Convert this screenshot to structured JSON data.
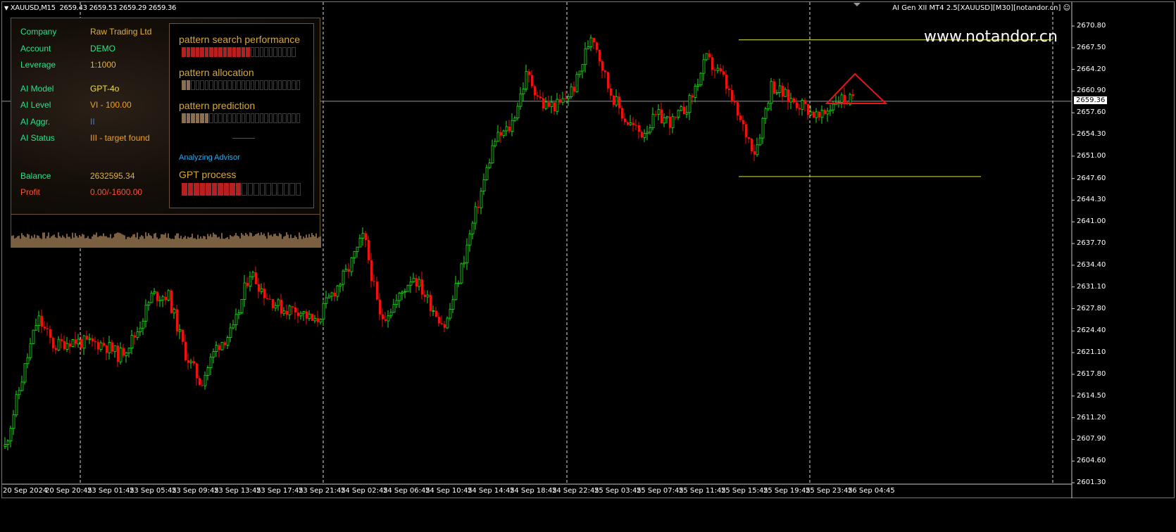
{
  "header": {
    "symbol": "XAUUSD,M15",
    "ohlc": "2659.43 2659.53 2659.29 2659.36",
    "ea_title": "AI Gen XII MT4 2.5[XAUUSD][M30][notandor.cn]",
    "watermark": "www.notandor.cn"
  },
  "info": [
    {
      "label": "Company",
      "value": "Raw Trading Ltd",
      "color": "#e0b040",
      "gap": false
    },
    {
      "label": "Account",
      "value": "DEMO",
      "color": "#2ee08a",
      "gap": false
    },
    {
      "label": "Leverage",
      "value": "1:1000",
      "color": "#e0b040",
      "gap": false
    },
    {
      "label": "AI Model",
      "value": "GPT-4o",
      "color": "#f0e040",
      "gap": true
    },
    {
      "label": "AI Level",
      "value": "VI - 100.00",
      "color": "#f0a020",
      "gap": false
    },
    {
      "label": "AI Aggr.",
      "value": "II",
      "color": "#3a7ae8",
      "gap": false
    },
    {
      "label": "AI Status",
      "value": "III - target found",
      "color": "#f0a020",
      "gap": false
    },
    {
      "label": "Balance",
      "value": "2632595.34",
      "color": "#e0b040",
      "gap": true
    },
    {
      "label": "Profit",
      "value": "0.00/-1600.00",
      "color": "#ff5030",
      "gap": false,
      "labelColor": "#ff5030"
    }
  ],
  "progress": [
    {
      "title": "pattern search performance",
      "filled": 15,
      "total": 25,
      "color": "#b82020"
    },
    {
      "title": "pattern allocation",
      "filled": 2,
      "total": 26,
      "color": "#8a7050"
    },
    {
      "title": "pattern prediction",
      "filled": 6,
      "total": 26,
      "color": "#8a7050"
    }
  ],
  "advisor": {
    "status": "Analyzing Advisor",
    "process_title": "GPT process",
    "filled": 10,
    "total": 20,
    "color": "#b82020"
  },
  "price_axis": {
    "labels": [
      "2670.80",
      "2667.50",
      "2664.20",
      "2660.90",
      "2657.60",
      "2654.30",
      "2651.00",
      "2647.60",
      "2644.30",
      "2641.00",
      "2637.70",
      "2634.40",
      "2631.10",
      "2627.80",
      "2624.40",
      "2621.10",
      "2617.80",
      "2614.50",
      "2611.20",
      "2607.90",
      "2604.60",
      "2601.30"
    ],
    "current": "2659.36"
  },
  "time_axis": [
    "20 Sep 2024",
    "20 Sep 20:45",
    "23 Sep 01:45",
    "23 Sep 05:45",
    "23 Sep 09:45",
    "23 Sep 13:45",
    "23 Sep 17:45",
    "23 Sep 21:45",
    "24 Sep 02:45",
    "24 Sep 06:45",
    "24 Sep 10:45",
    "24 Sep 14:45",
    "24 Sep 18:45",
    "24 Sep 22:45",
    "25 Sep 03:45",
    "25 Sep 07:45",
    "25 Sep 11:45",
    "25 Sep 15:45",
    "25 Sep 19:45",
    "25 Sep 23:45",
    "26 Sep 04:45"
  ],
  "chart_data": {
    "type": "candlestick",
    "symbol": "XAUUSD",
    "timeframe": "M15",
    "ylim": [
      2601.3,
      2670.8
    ],
    "bull_color": "#22dd22",
    "bear_color": "#ee1111",
    "anchor_closes": [
      2606.8,
      2616.8,
      2626.4,
      2622,
      2623,
      2622.5,
      2622.5,
      2620.6,
      2623.8,
      2629.8,
      2629.8,
      2621.2,
      2616.4,
      2622.2,
      2624.4,
      2633.5,
      2629.8,
      2627.7,
      2627.7,
      2625.5,
      2629.8,
      2633.5,
      2638.9,
      2626.1,
      2628.8,
      2633.0,
      2628.8,
      2625.0,
      2634.1,
      2643.7,
      2653.3,
      2655.4,
      2663.5,
      2658.7,
      2658.7,
      2661.9,
      2670.0,
      2661.4,
      2656.6,
      2654.4,
      2657.1,
      2656.1,
      2659.3,
      2665.7,
      2663.0,
      2656.6,
      2651.7,
      2661.9,
      2659.8,
      2658.7,
      2656.6,
      2659.8,
      2659.4
    ],
    "levels": {
      "upper": 2668.7,
      "lower": 2647.9,
      "current": 2659.36
    }
  }
}
